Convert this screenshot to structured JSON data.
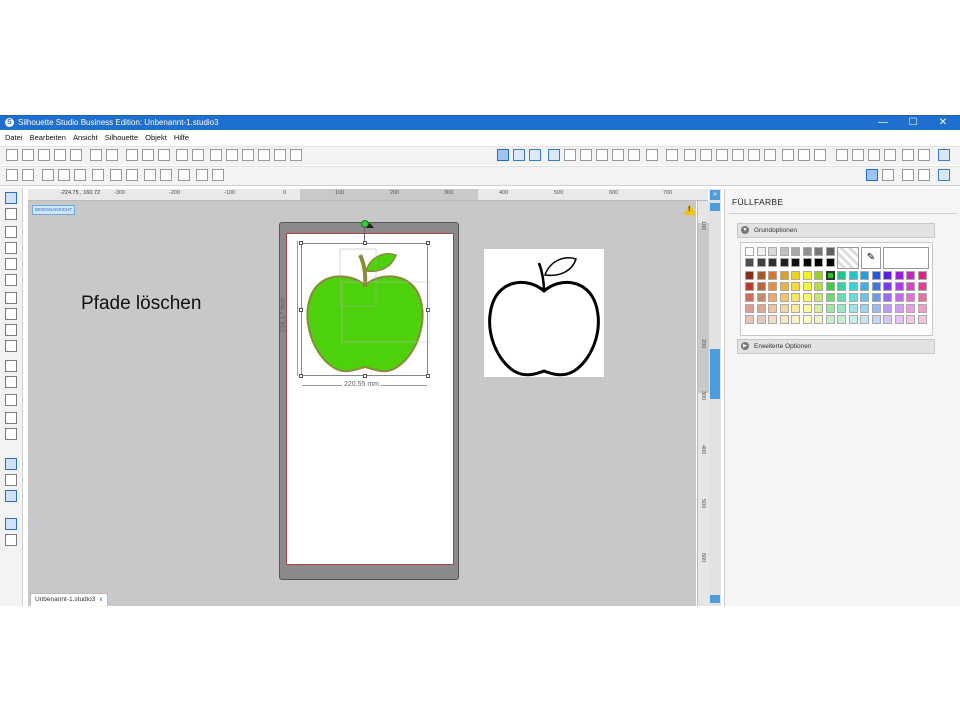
{
  "window": {
    "title": "Silhouette Studio Business Edition: Unbenannt-1.studio3",
    "controls": {
      "minimize": "—",
      "maximize": "☐",
      "close": "✕"
    }
  },
  "menu": [
    "Datei",
    "Bearbeiten",
    "Ansicht",
    "Silhouette",
    "Objekt",
    "Hilfe"
  ],
  "ruler": {
    "coordinates": "-224.75 , 160.72",
    "top_ticks": [
      "-300",
      "-200",
      "-100",
      "0",
      "100",
      "200",
      "300",
      "400",
      "500",
      "600",
      "700"
    ],
    "right_ticks": [
      "100",
      "200",
      "300",
      "400",
      "500",
      "600"
    ]
  },
  "canvas": {
    "design_badge": "DESIGNANSICHT",
    "overlay_text": "Pfade löschen",
    "dim_height": "234.17 mm",
    "dim_width": "220.55 mm",
    "apple_fill_color": "#4cd10a",
    "apple_stroke_color": "#8a8a3a"
  },
  "panel": {
    "title": "FÜLLFARBE",
    "section_basic": "Grundoptionen",
    "section_advanced": "Erweiterte Optionen",
    "selected_swatch": "#1ec81e",
    "palette_rows": [
      [
        "#ffffff",
        "#f0f0f0",
        "#d8d8d8",
        "#c0c0c0",
        "#a8a8a8",
        "#909090",
        "#787878",
        "#606060"
      ],
      [
        "#505050",
        "#404040",
        "#303030",
        "#202020",
        "#101010",
        "#000000",
        "#000000",
        "#000000"
      ],
      [
        "#8a2b1c",
        "#a45a2a",
        "#e3741f",
        "#e59f1f",
        "#f2d11a",
        "#f2f21a",
        "#9bd21a",
        "#1ec81e",
        "#1ec88a",
        "#1ec8c8",
        "#1e9ee8",
        "#1e5ae8",
        "#5a1ee8",
        "#9a1ee8",
        "#d21ec8",
        "#e81e7a"
      ],
      [
        "#c0392b",
        "#b9683b",
        "#ef8b3a",
        "#f0b33a",
        "#f5dc3a",
        "#f5f53a",
        "#b4e03a",
        "#3ad23a",
        "#3ad29e",
        "#3ad2d2",
        "#3ab1ef",
        "#3a77ef",
        "#773aef",
        "#b03aef",
        "#df3ad2",
        "#ef3a8d"
      ],
      [
        "#d46a5e",
        "#c98a66",
        "#f2a86a",
        "#f3c66a",
        "#f8e56a",
        "#f8f86a",
        "#c8e86a",
        "#6adc6a",
        "#6adcb4",
        "#6adcdc",
        "#6ac4f2",
        "#6a9cf2",
        "#9c6af2",
        "#c46af2",
        "#e86adc",
        "#f26aa8"
      ],
      [
        "#e09a92",
        "#d8ab8f",
        "#f5c39a",
        "#f6d79a",
        "#fae99a",
        "#fafa9a",
        "#d8ef9a",
        "#9ae69a",
        "#9ae6c9",
        "#9ae6e6",
        "#9ad5f5",
        "#9abcf5",
        "#bc9af5",
        "#d59af5",
        "#ef9ae6",
        "#f59ac2"
      ],
      [
        "#ebc1bc",
        "#e5c9b8",
        "#f8dac4",
        "#f9e6c4",
        "#fcf2c4",
        "#fcfcc4",
        "#e6f5c4",
        "#c4efc4",
        "#c4efdd",
        "#c4efef",
        "#c4e3f8",
        "#c4d6f8",
        "#d6c4f8",
        "#e3c4f8",
        "#f5c4ef",
        "#f8c4da"
      ]
    ]
  },
  "tab": {
    "name": "Unbenannt-1.studio3",
    "close": "x"
  }
}
